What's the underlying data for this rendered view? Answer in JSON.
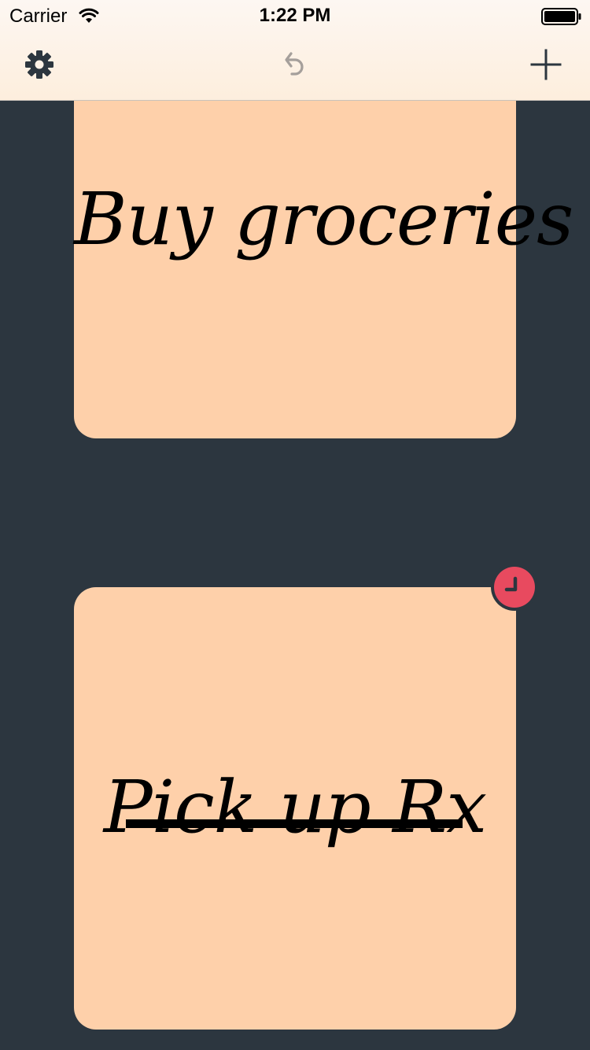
{
  "status_bar": {
    "carrier": "Carrier",
    "time": "1:22 PM",
    "wifi_icon": "wifi-icon",
    "battery_icon": "battery-icon"
  },
  "toolbar": {
    "settings_icon": "gear-icon",
    "undo_icon": "undo-icon",
    "add_icon": "plus-icon"
  },
  "notes": [
    {
      "text": "Buy groceries",
      "completed": false,
      "color": "#fed0aa"
    },
    {
      "text": "Pick up Rx",
      "completed": true,
      "has_reminder": true,
      "reminder_icon": "clock-icon",
      "color": "#fed0aa"
    }
  ],
  "colors": {
    "background": "#2c363f",
    "note": "#fed0aa",
    "reminder_badge": "#e84a5f",
    "toolbar_bg": "#fdeedd"
  }
}
